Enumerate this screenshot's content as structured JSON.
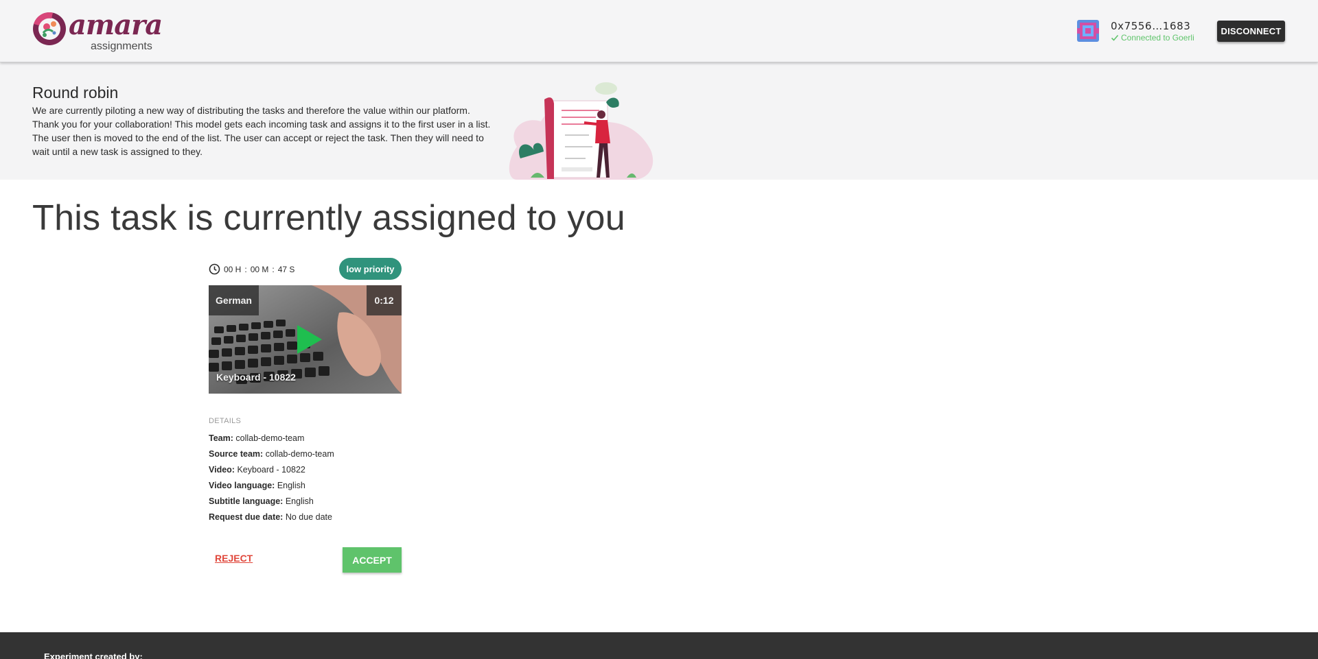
{
  "header": {
    "logo_word": "amara",
    "logo_subtitle": "assignments",
    "wallet": {
      "address": "0x7556…1683",
      "network_status": "Connected to Goerli"
    },
    "disconnect_label": "DISCONNECT"
  },
  "info": {
    "title": "Round robin",
    "description": "We are currently piloting a new way of distributing the tasks and therefore the value within our platform. Thank you for your collaboration! This model gets each incoming task and assigns it to the first user in a list. The user then is moved to the end of the list. The user can accept or reject the task. Then they will need to wait until a new task is assigned to they."
  },
  "main": {
    "title": "This task is currently assigned to you"
  },
  "task": {
    "timer": {
      "hours": "00 H",
      "minutes": "00 M",
      "seconds": "47 S"
    },
    "priority": "low priority",
    "video": {
      "language": "German",
      "duration": "0:12",
      "title": "Keyboard - 10822"
    },
    "details_heading": "DETAILS",
    "details": [
      {
        "label": "Team:",
        "value": "collab-demo-team"
      },
      {
        "label": "Source team:",
        "value": "collab-demo-team"
      },
      {
        "label": "Video:",
        "value": "Keyboard - 10822"
      },
      {
        "label": "Video language:",
        "value": "English"
      },
      {
        "label": "Subtitle language:",
        "value": "English"
      },
      {
        "label": "Request due date:",
        "value": "No due date"
      }
    ],
    "reject_label": "REJECT",
    "accept_label": "ACCEPT"
  },
  "footer": {
    "text": "Experiment created by:"
  },
  "colors": {
    "brand": "#7b2752",
    "priority": "#30937c",
    "accept": "#5fc36b",
    "reject": "#e0463a",
    "connected": "#5fc46b",
    "footer": "#333333"
  }
}
